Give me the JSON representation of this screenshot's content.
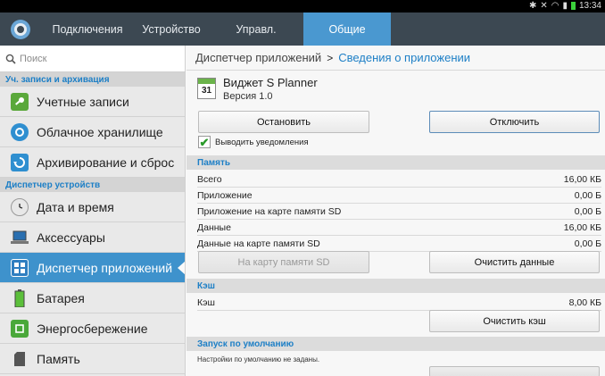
{
  "status_bar": {
    "time": "13:34",
    "icons": [
      "bluetooth-icon",
      "mute-icon",
      "wifi-icon",
      "signal-icon",
      "battery-icon"
    ]
  },
  "tabs": [
    {
      "label": "Подключения",
      "active": false
    },
    {
      "label": "Устройство",
      "active": false
    },
    {
      "label": "Управл.",
      "active": false
    },
    {
      "label": "Общие",
      "active": true
    }
  ],
  "sidebar": {
    "search_placeholder": "Поиск",
    "section1": "Уч. записи и архивация",
    "items1": [
      {
        "label": "Учетные записи",
        "icon": "key-icon"
      },
      {
        "label": "Облачное хранилище",
        "icon": "cloud-icon"
      },
      {
        "label": "Архивирование и сброс",
        "icon": "backup-icon"
      }
    ],
    "section2": "Диспетчер устройств",
    "items2": [
      {
        "label": "Дата и время",
        "icon": "clock-icon"
      },
      {
        "label": "Аксессуары",
        "icon": "laptop-icon"
      },
      {
        "label": "Диспетчер приложений",
        "icon": "grid-icon",
        "active": true
      },
      {
        "label": "Батарея",
        "icon": "battery-icon"
      },
      {
        "label": "Энергосбережение",
        "icon": "power-save-icon"
      },
      {
        "label": "Память",
        "icon": "sd-card-icon"
      }
    ]
  },
  "breadcrumb": {
    "parent": "Диспетчер приложений",
    "separator": ">",
    "current": "Сведения о приложении"
  },
  "app": {
    "name": "Виджет S Planner",
    "version": "Версия 1.0",
    "icon_day": "31"
  },
  "buttons": {
    "stop": "Остановить",
    "disable": "Отключить",
    "move_sd": "На карту памяти SD",
    "clear_data": "Очистить данные",
    "clear_cache": "Очистить кэш"
  },
  "notifications_checkbox": {
    "label": "Выводить уведомления",
    "checked": true
  },
  "memory": {
    "header": "Память",
    "rows": [
      {
        "label": "Всего",
        "value": "16,00 КБ"
      },
      {
        "label": "Приложение",
        "value": "0,00 Б"
      },
      {
        "label": "Приложение на карте памяти SD",
        "value": "0,00 Б"
      },
      {
        "label": "Данные",
        "value": "16,00 КБ"
      },
      {
        "label": "Данные на карте памяти SD",
        "value": "0,00 Б"
      }
    ]
  },
  "cache": {
    "header": "Кэш",
    "label": "Кэш",
    "value": "8,00 КБ"
  },
  "defaults": {
    "header": "Запуск по умолчанию",
    "note": "Настройки по умолчанию не заданы."
  },
  "colors": {
    "accent": "#4a98d0",
    "tabbar": "#3c4852",
    "section_text": "#1d7fc6"
  }
}
